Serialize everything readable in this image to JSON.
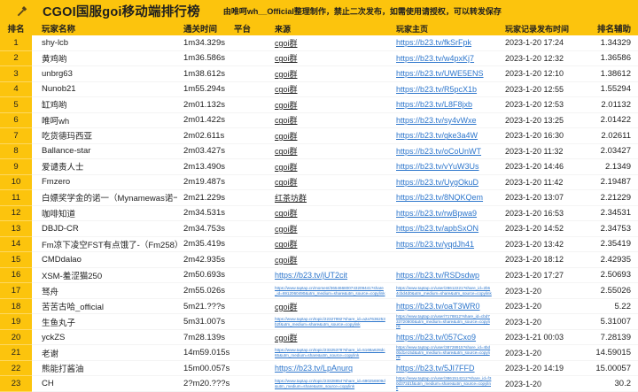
{
  "header": {
    "title": "CGOI国服goi移动端排行榜",
    "note": "由唯呵wh__Official整理制作，禁止二次发布，如需使用请授权，可以转发保存",
    "icon": "hammer-icon"
  },
  "colors": {
    "accent": "#fcc40d",
    "link_blue": "#2d76cc",
    "text": "#1f1f1f"
  },
  "columns": [
    "排名",
    "玩家名称",
    "通关时间",
    "平台",
    "来源",
    "玩家主页",
    "玩家记录发布时间",
    "排名辅助"
  ],
  "rows": [
    {
      "rank": "1",
      "name": "shy-lcb",
      "time": "1m34.329s",
      "platform": "",
      "source": {
        "text": "cgoi群",
        "style": "group"
      },
      "homepage": {
        "text": "https://b23.tv/fkSrFpk",
        "style": "link"
      },
      "published": "2023-1-20 17:24",
      "aux": "1.34329"
    },
    {
      "rank": "2",
      "name": "黄鸡哟",
      "time": "1m36.586s",
      "platform": "",
      "source": {
        "text": "cgoi群",
        "style": "group"
      },
      "homepage": {
        "text": "https://b23.tv/w4pxKj7",
        "style": "link"
      },
      "published": "2023-1-20 12:32",
      "aux": "1.36586"
    },
    {
      "rank": "3",
      "name": "unbrg63",
      "time": "1m38.612s",
      "platform": "",
      "source": {
        "text": "cgoi群",
        "style": "group"
      },
      "homepage": {
        "text": "https://b23.tv/UWE5ENS",
        "style": "link"
      },
      "published": "2023-1-20 12:10",
      "aux": "1.38612"
    },
    {
      "rank": "4",
      "name": "Nunob21",
      "time": "1m55.294s",
      "platform": "",
      "source": {
        "text": "cgoi群",
        "style": "group"
      },
      "homepage": {
        "text": "https://b23.tv/R5pcX1b",
        "style": "link"
      },
      "published": "2023-1-20 12:55",
      "aux": "1.55294"
    },
    {
      "rank": "5",
      "name": "缸鸡哟",
      "time": "2m01.132s",
      "platform": "",
      "source": {
        "text": "cgoi群",
        "style": "group"
      },
      "homepage": {
        "text": "https://b23.tv/L8F8jxb",
        "style": "link"
      },
      "published": "2023-1-20 12:53",
      "aux": "2.01132"
    },
    {
      "rank": "6",
      "name": "唯呵wh",
      "time": "2m01.422s",
      "platform": "",
      "source": {
        "text": "cgoi群",
        "style": "group"
      },
      "homepage": {
        "text": "https://b23.tv/sy4vWxe",
        "style": "link"
      },
      "published": "2023-1-20 13:25",
      "aux": "2.01422"
    },
    {
      "rank": "7",
      "name": "吃货德玛西亚",
      "time": "2m02.611s",
      "platform": "",
      "source": {
        "text": "cgoi群",
        "style": "group"
      },
      "homepage": {
        "text": "https://b23.tv/gke3a4W",
        "style": "link"
      },
      "published": "2023-1-20 16:30",
      "aux": "2.02611"
    },
    {
      "rank": "8",
      "name": "Ballance-star",
      "time": "2m03.427s",
      "platform": "",
      "source": {
        "text": "cgoi群",
        "style": "group"
      },
      "homepage": {
        "text": "https://b23.tv/oCoUnWT",
        "style": "link"
      },
      "published": "2023-1-20 11:32",
      "aux": "2.03427"
    },
    {
      "rank": "9",
      "name": "爱谴责人士",
      "time": "2m13.490s",
      "platform": "",
      "source": {
        "text": "cgoi群",
        "style": "group"
      },
      "homepage": {
        "text": "https://b23.tv/vYuW3Us",
        "style": "link"
      },
      "published": "2023-1-20 14:46",
      "aux": "2.1349"
    },
    {
      "rank": "10",
      "name": "Fmzero",
      "time": "2m19.487s",
      "platform": "",
      "source": {
        "text": "cgoi群",
        "style": "group"
      },
      "homepage": {
        "text": "https://b23.tv/UygOkuD",
        "style": "link"
      },
      "published": "2023-1-20 11:42",
      "aux": "2.19487"
    },
    {
      "rank": "11",
      "name": "白嫖奖学金的诺一（Mynamewas诺一）",
      "time": "2m21.229s",
      "platform": "",
      "source": {
        "text": "红茶坊群",
        "style": "group"
      },
      "homepage": {
        "text": "https://b23.tv/8NQKQem",
        "style": "link"
      },
      "published": "2023-1-20 13:07",
      "aux": "2.21229"
    },
    {
      "rank": "12",
      "name": "咖啡知道",
      "time": "2m34.531s",
      "platform": "",
      "source": {
        "text": "cgoi群",
        "style": "group"
      },
      "homepage": {
        "text": "https://b23.tv/rwBpwa9",
        "style": "link"
      },
      "published": "2023-1-20 16:53",
      "aux": "2.34531"
    },
    {
      "rank": "13",
      "name": "DBJD-CR",
      "time": "2m34.753s",
      "platform": "",
      "source": {
        "text": "cgoi群",
        "style": "group"
      },
      "homepage": {
        "text": "https://b23.tv/apbSxON",
        "style": "link"
      },
      "published": "2023-1-20 14:52",
      "aux": "2.34753"
    },
    {
      "rank": "14",
      "name": "Fm凉下凌空FST有点饿了-（Fm258）",
      "time": "2m35.419s",
      "platform": "",
      "source": {
        "text": "cgoi群",
        "style": "group"
      },
      "homepage": {
        "text": "https://b23.tv/yqdJh41",
        "style": "link"
      },
      "published": "2023-1-20 13:42",
      "aux": "2.35419"
    },
    {
      "rank": "15",
      "name": "CMDdalao",
      "time": "2m42.935s",
      "platform": "",
      "source": {
        "text": "cgoi群",
        "style": "group"
      },
      "homepage": {
        "text": "",
        "style": "none"
      },
      "published": "2023-1-20 18:12",
      "aux": "2.42935"
    },
    {
      "rank": "16",
      "name": "XSM-羞涩猫250",
      "time": "2m50.693s",
      "platform": "",
      "source": {
        "text": "https://b23.tv/jUT2cit",
        "style": "link"
      },
      "homepage": {
        "text": "https://b23.tv/RSDsdwp",
        "style": "link"
      },
      "published": "2023-1-20 17:27",
      "aux": "2.50693"
    },
    {
      "rank": "17",
      "name": "驽舟",
      "time": "2m55.026s",
      "platform": "",
      "source": {
        "text": "https://www.taptap.cn/moment/365466800743209441?share_id=6912060490&utm_medium=share&utm_source=copylink",
        "style": "tiny"
      },
      "homepage": {
        "text": "https://www.taptap.cn/user/28612221?share_id=2b54cbd4d0&utm_medium=share&utm_source=copylink",
        "style": "tiny"
      },
      "published": "2023-1-20",
      "aux": "2.55026"
    },
    {
      "rank": "18",
      "name": "苦苦古哈_official",
      "time": "5m21.???s",
      "platform": "",
      "source": {
        "text": "cgoi群",
        "style": "group"
      },
      "homepage": {
        "text": "https://b23.tv/oaT3WR0",
        "style": "link"
      },
      "published": "2023-1-20",
      "aux": "5.22"
    },
    {
      "rank": "19",
      "name": "生鱼丸子",
      "time": "5m31.007s",
      "platform": "",
      "source": {
        "text": "https://www.taptap.cn/topic/22327992?share_id=a2a7636253b2f&utm_medium=share&utm_source=copylink",
        "style": "tiny"
      },
      "homepage": {
        "text": "https://www.taptap.cn/user/7178812?share_id=cbd733720800&utm_medium=share&utm_source=copylink",
        "style": "tiny"
      },
      "published": "2023-1-20",
      "aux": "5.31007"
    },
    {
      "rank": "20",
      "name": "yckZS",
      "time": "7m28.139s",
      "platform": "",
      "source": {
        "text": "cgoi群",
        "style": "group"
      },
      "homepage": {
        "text": "https://b23.tv/057Cxo9",
        "style": "link"
      },
      "published": "2023-1-21 00:03",
      "aux": "7.28139"
    },
    {
      "rank": "21",
      "name": "老谢",
      "time": "14m59.015s",
      "platform": "",
      "source": {
        "text": "https://www.taptap.cn/topic/23325378?share_id=5168a628dc65&utm_medium=share&utm_source=copylink",
        "style": "tiny"
      },
      "homepage": {
        "text": "https://www.taptap.cn/user/38728915?share_id=4bd0bd1e15d&utm_medium=share&utm_source=copylink",
        "style": "tiny"
      },
      "published": "2023-1-20",
      "aux": "14.59015"
    },
    {
      "rank": "22",
      "name": "熊能打酱油",
      "time": "15m00.057s",
      "platform": "",
      "source": {
        "text": "https://b23.tv/LpAnurq",
        "style": "link"
      },
      "homepage": {
        "text": "https://b23.tv/5JI7FFD",
        "style": "link"
      },
      "published": "2023-1-20 14:19",
      "aux": "15.00057"
    },
    {
      "rank": "23",
      "name": "CH",
      "time": "2?m20.???s",
      "platform": "",
      "source": {
        "text": "https://www.taptap.cn/topic/23328854?share_id=690256909d&utm_medium=share&utm_source=copylink",
        "style": "tiny"
      },
      "homepage": {
        "text": "https://www.taptap.cn/user/3861514212?share_id=f30d372d1f&utm_medium=share&utm_source=copylink",
        "style": "tiny"
      },
      "published": "2023-1-20",
      "aux": "30.2"
    }
  ]
}
